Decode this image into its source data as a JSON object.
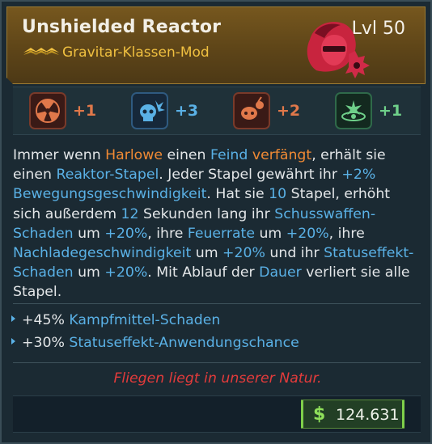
{
  "item": {
    "name": "Unshielded Reactor",
    "level": "Lvl 50",
    "type": "Gravitar-Klassen-Mod",
    "rarity_icon": "legendary-chevrons-icon",
    "portrait_icon": "harlowe-portrait-icon"
  },
  "skills": [
    {
      "icon": "radiation-skill-icon",
      "value": "+1",
      "color": "#e0784a"
    },
    {
      "icon": "skull-skill-icon",
      "value": "+3",
      "color": "#5ab1e6"
    },
    {
      "icon": "bomb-skill-icon",
      "value": "+2",
      "color": "#e0784a"
    },
    {
      "icon": "orbit-skill-icon",
      "value": "+1",
      "color": "#6fd08a"
    }
  ],
  "description": {
    "t1": "Immer wenn ",
    "harlowe": "Harlowe",
    "t2": " einen ",
    "feind": "Feind",
    "t3": " ",
    "verfaengt": "verfängt",
    "t4": ", erhält sie einen ",
    "reaktor": "Reaktor-Stapel",
    "t5": ". Jeder Stapel gewährt ihr ",
    "pct1": "+2%",
    "t6": " ",
    "bewegung": "Bewegungsgeschwindigkeit",
    "t7": ". Hat sie ",
    "zehn": "10",
    "t8": " Stapel, erhöht sich außerdem ",
    "zwoelf": "12",
    "t9": " Sekunden lang ihr ",
    "schuss": "Schusswaffen-Schaden",
    "t10": " um ",
    "pct2": "+20%",
    "t11": ", ihre ",
    "feuerrate": "Feuerrate",
    "t12": " um ",
    "pct3": "+20%",
    "t13": ", ihre ",
    "nachlade": "Nachladegeschwindigkeit",
    "t14": " um ",
    "pct4": "+20%",
    "t15": " und ihr ",
    "status": "Statuseffekt-Schaden",
    "t16": " um ",
    "pct5": "+20%",
    "t17": ". Mit Ablauf der ",
    "dauer": "Dauer",
    "t18": " verliert sie alle Stapel."
  },
  "stats": [
    {
      "value": "+45%",
      "label": "Kampfmittel-Schaden"
    },
    {
      "value": "+30%",
      "label": "Statuseffekt-Anwendungschance"
    }
  ],
  "flavor_text": "Fliegen liegt in unserer Natur.",
  "price": {
    "currency_icon": "dollar-icon",
    "symbol": "$",
    "value": "124.631"
  },
  "colors": {
    "accent_orange": "#f08a34",
    "accent_blue": "#5ab1e6",
    "legendary_gold": "#f0c040",
    "flavor_red": "#e33b3b",
    "money_green": "#8fe05a"
  }
}
